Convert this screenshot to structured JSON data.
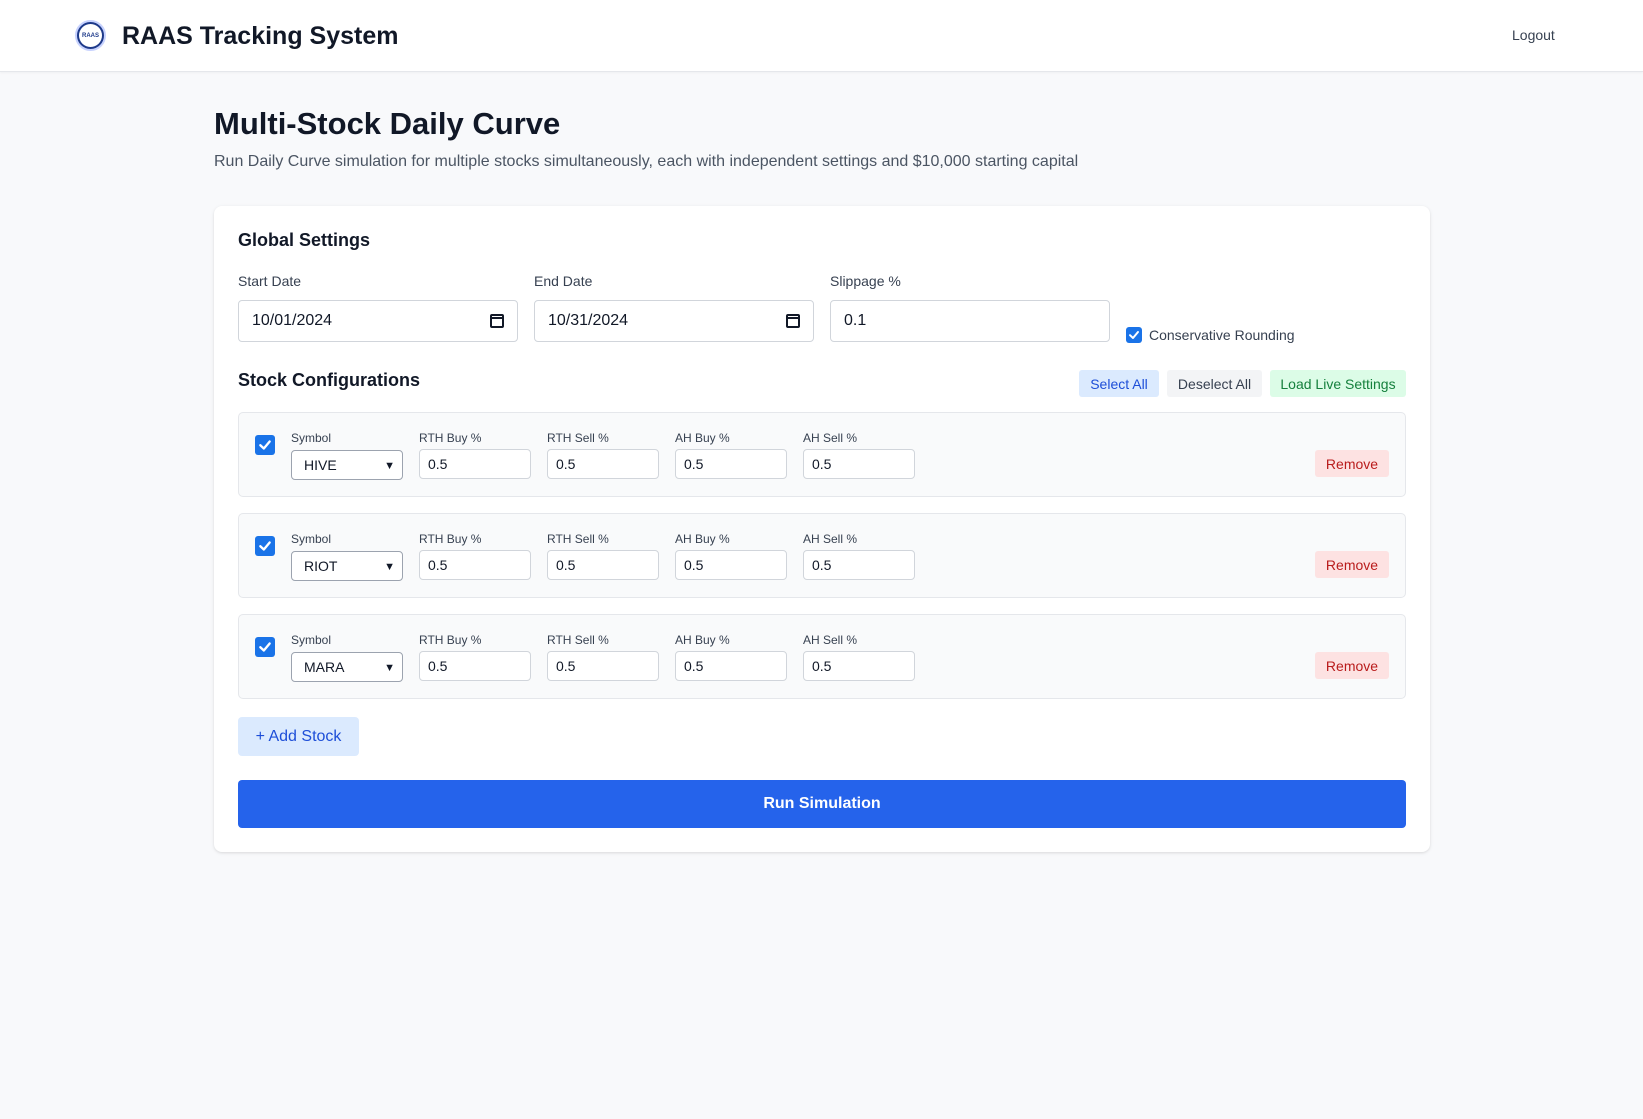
{
  "header": {
    "logo_text": "RAAS",
    "app_title": "RAAS Tracking System",
    "logout_label": "Logout"
  },
  "page": {
    "title": "Multi-Stock Daily Curve",
    "subtitle": "Run Daily Curve simulation for multiple stocks simultaneously, each with independent settings and $10,000 starting capital"
  },
  "global_settings": {
    "title": "Global Settings",
    "start_date_label": "Start Date",
    "start_date_value": "10/01/2024",
    "end_date_label": "End Date",
    "end_date_value": "10/31/2024",
    "slippage_label": "Slippage %",
    "slippage_value": "0.1",
    "conservative_rounding_label": "Conservative Rounding",
    "conservative_rounding_checked": true
  },
  "stock_config": {
    "title": "Stock Configurations",
    "select_all_label": "Select All",
    "deselect_all_label": "Deselect All",
    "load_live_label": "Load Live Settings",
    "field_labels": {
      "symbol": "Symbol",
      "rth_buy": "RTH Buy %",
      "rth_sell": "RTH Sell %",
      "ah_buy": "AH Buy %",
      "ah_sell": "AH Sell %"
    },
    "remove_label": "Remove",
    "rows": [
      {
        "checked": true,
        "symbol": "HIVE",
        "rth_buy": "0.5",
        "rth_sell": "0.5",
        "ah_buy": "0.5",
        "ah_sell": "0.5"
      },
      {
        "checked": true,
        "symbol": "RIOT",
        "rth_buy": "0.5",
        "rth_sell": "0.5",
        "ah_buy": "0.5",
        "ah_sell": "0.5"
      },
      {
        "checked": true,
        "symbol": "MARA",
        "rth_buy": "0.5",
        "rth_sell": "0.5",
        "ah_buy": "0.5",
        "ah_sell": "0.5"
      }
    ],
    "add_stock_label": "+ Add Stock"
  },
  "actions": {
    "run_label": "Run Simulation"
  },
  "colors": {
    "primary": "#2563eb",
    "checkbox": "#1a73e8",
    "remove_bg": "#fde2e2",
    "remove_text": "#b91c1c",
    "load_live_bg": "#dcfce7"
  },
  "icons": {
    "logo": "raas-logo-icon",
    "calendar": "calendar-icon",
    "dropdown": "chevron-down-icon",
    "checkbox": "checkmark-icon"
  }
}
